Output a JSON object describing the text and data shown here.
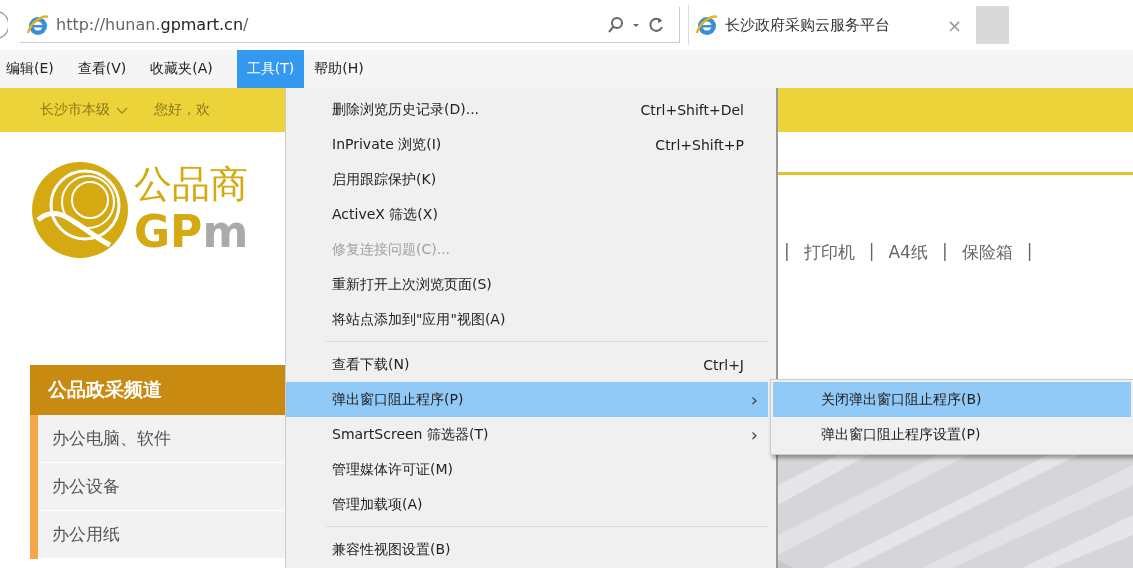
{
  "address_bar": {
    "url": "http://hunan.**gpmart.cn**/"
  },
  "tabs": [
    {
      "title": "长沙政府采购云服务平台",
      "close": "×",
      "selected": true
    }
  ],
  "menu_bar": [
    {
      "label": "编辑(E)",
      "selected": false
    },
    {
      "label": "查看(V)",
      "selected": false
    },
    {
      "label": "收藏夹(A)",
      "selected": false
    },
    {
      "label": "工具(T)",
      "selected": true
    },
    {
      "label": "帮助(H)",
      "selected": false
    }
  ],
  "page": {
    "region": "长沙市本级",
    "greeting": "您好，欢",
    "logo_cn": "公品商",
    "logo_en_gold": "GP",
    "logo_en_grey": "m",
    "hot_words": [
      "|",
      "打印机",
      "|",
      "A4纸",
      "|",
      "保险箱",
      "|"
    ],
    "category_title": "公品政采频道",
    "categories": [
      "办公电脑、软件",
      "办公设备",
      "办公用纸"
    ]
  },
  "menu": [
    {
      "kind": "item",
      "label": "删除浏览历史记录(D)...",
      "shortcut": "Ctrl+Shift+Del",
      "disabled": false,
      "selected": false
    },
    {
      "kind": "item",
      "label": "InPrivate 浏览(I)",
      "shortcut": "Ctrl+Shift+P",
      "disabled": false,
      "selected": false
    },
    {
      "kind": "item",
      "label": "启用跟踪保护(K)",
      "disabled": false,
      "selected": false
    },
    {
      "kind": "item",
      "label": "ActiveX 筛选(X)",
      "disabled": false,
      "selected": false
    },
    {
      "kind": "item",
      "label": "修复连接问题(C)...",
      "disabled": true,
      "selected": false
    },
    {
      "kind": "item",
      "label": "重新打开上次浏览页面(S)",
      "disabled": false,
      "selected": false
    },
    {
      "kind": "item",
      "label": "将站点添加到\"应用\"视图(A)",
      "disabled": false,
      "selected": false
    },
    {
      "kind": "separator"
    },
    {
      "kind": "item",
      "label": "查看下载(N)",
      "shortcut": "Ctrl+J",
      "disabled": false,
      "selected": false
    },
    {
      "kind": "item",
      "label": "弹出窗口阻止程序(P)",
      "arrow": "›",
      "disabled": false,
      "selected": true
    },
    {
      "kind": "item",
      "label": "SmartScreen 筛选器(T)",
      "arrow": "›",
      "disabled": false,
      "selected": false
    },
    {
      "kind": "item",
      "label": "管理媒体许可证(M)",
      "disabled": false,
      "selected": false
    },
    {
      "kind": "item",
      "label": "管理加载项(A)",
      "disabled": false,
      "selected": false
    },
    {
      "kind": "separator"
    },
    {
      "kind": "item",
      "label": "兼容性视图设置(B)",
      "disabled": false,
      "selected": false
    }
  ],
  "submenu": [
    {
      "label": "关闭弹出窗口阻止程序(B)",
      "selected": true
    },
    {
      "label": "弹出窗口阻止程序设置(P)",
      "selected": false
    }
  ]
}
